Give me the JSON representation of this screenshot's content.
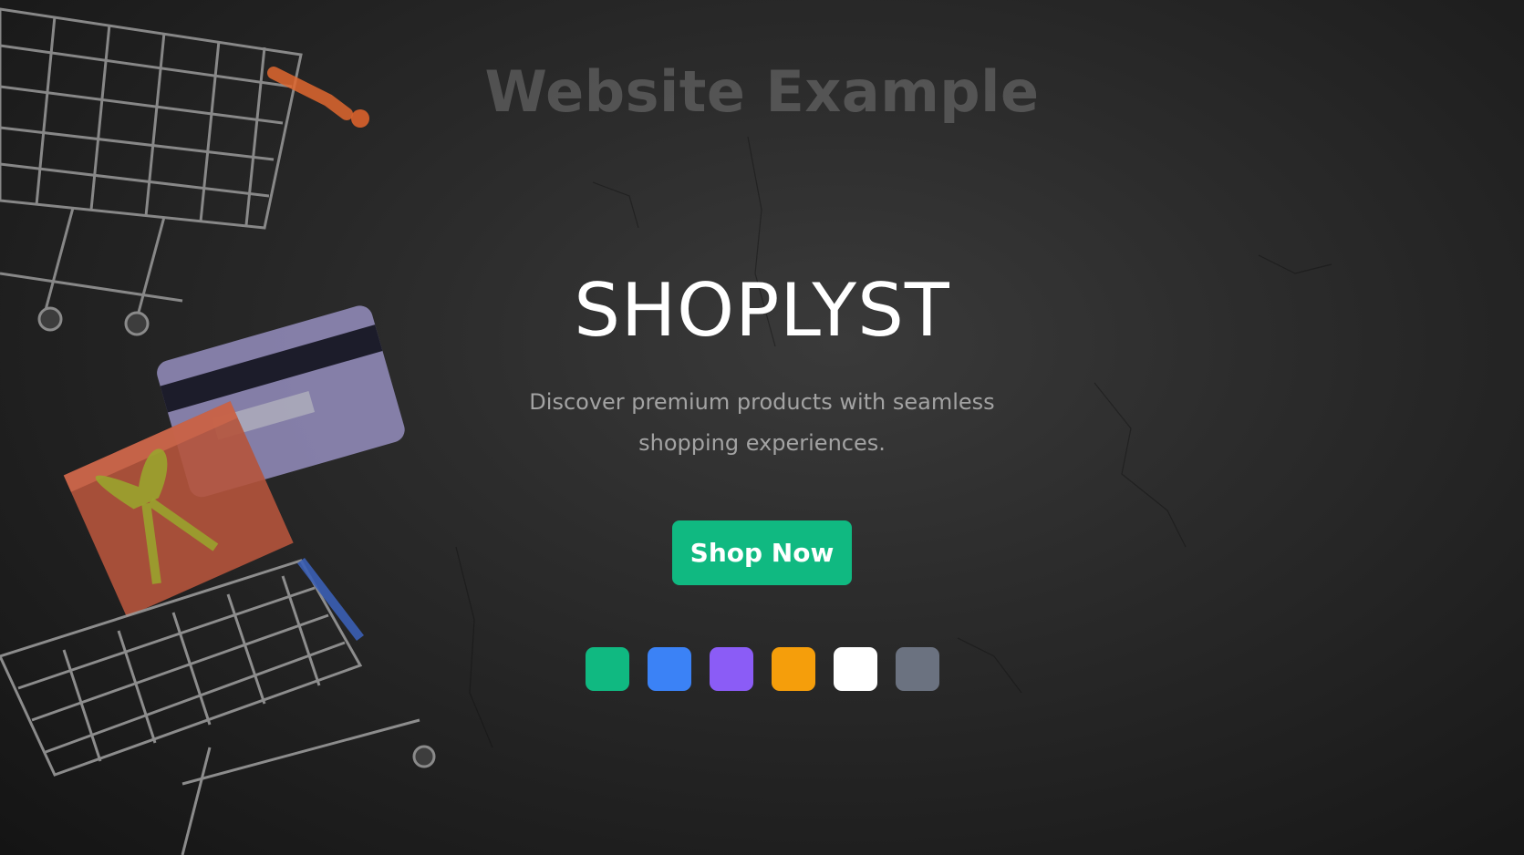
{
  "header": {
    "site_label": "Website Example"
  },
  "hero": {
    "brand": "SHOPLYST",
    "tagline": "Discover premium products with seamless shopping experiences.",
    "cta_label": "Shop Now",
    "cta_color": "#10b981"
  },
  "palette": {
    "swatches": [
      {
        "name": "green",
        "color": "#10b981"
      },
      {
        "name": "blue",
        "color": "#3b82f6"
      },
      {
        "name": "purple",
        "color": "#8b5cf6"
      },
      {
        "name": "orange",
        "color": "#f59e0b"
      },
      {
        "name": "white",
        "color": "#ffffff"
      },
      {
        "name": "gray",
        "color": "#6b7280"
      }
    ]
  },
  "background": {
    "base_color": "#2a2a2a",
    "decor_icons": [
      "shopping-cart-icon",
      "credit-card-icon",
      "gift-box-icon",
      "shopping-cart-icon"
    ]
  }
}
